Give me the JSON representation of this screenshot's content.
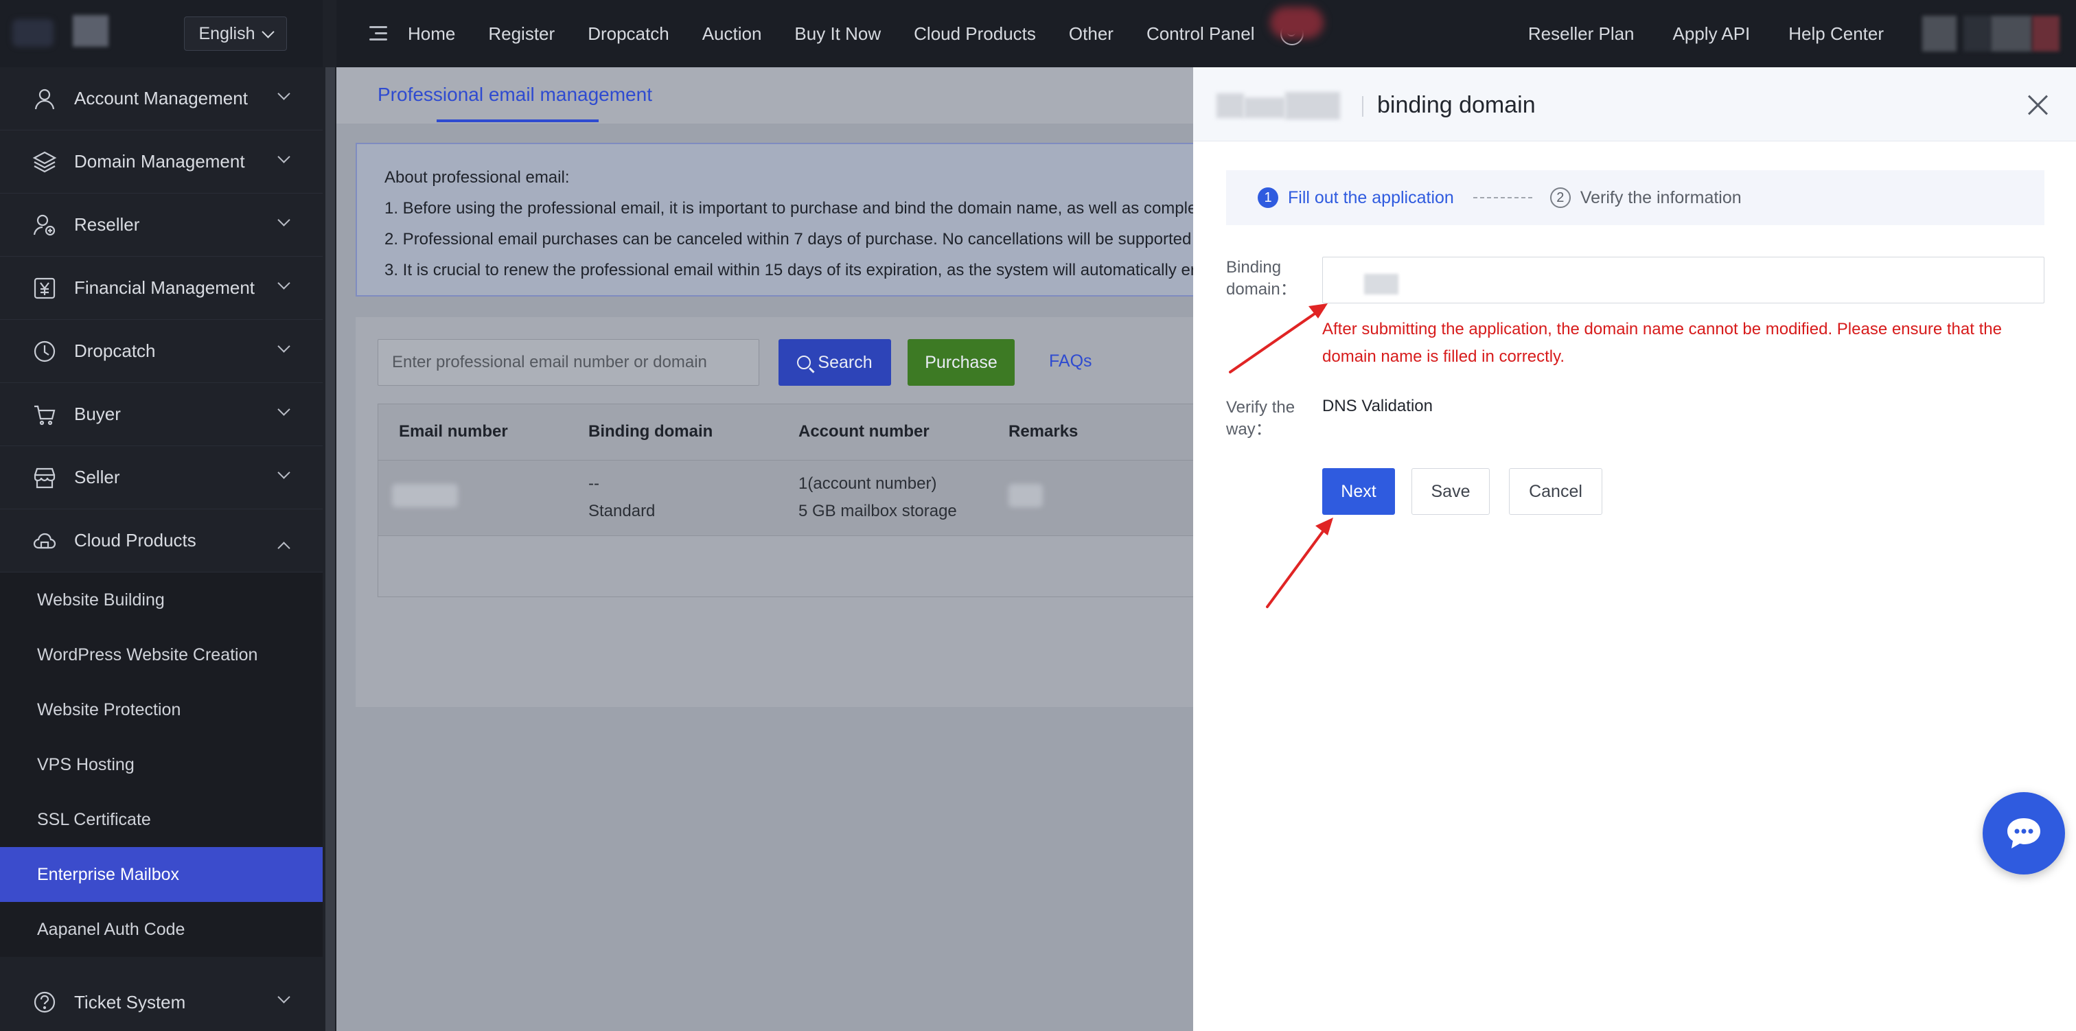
{
  "sidebar": {
    "language": "English",
    "items": [
      {
        "label": "Account Management",
        "icon": "user-icon"
      },
      {
        "label": "Domain Management",
        "icon": "layers-icon"
      },
      {
        "label": "Reseller",
        "icon": "reseller-icon"
      },
      {
        "label": "Financial Management",
        "icon": "yen-icon"
      },
      {
        "label": "Dropcatch",
        "icon": "clock-icon"
      },
      {
        "label": "Buyer",
        "icon": "cart-icon"
      },
      {
        "label": "Seller",
        "icon": "store-icon"
      },
      {
        "label": "Cloud Products",
        "icon": "cloud-icon"
      }
    ],
    "cloud_sub": [
      {
        "label": "Website Building"
      },
      {
        "label": "WordPress Website Creation"
      },
      {
        "label": "Website Protection"
      },
      {
        "label": "VPS Hosting"
      },
      {
        "label": "SSL Certificate"
      },
      {
        "label": "Enterprise Mailbox"
      },
      {
        "label": "Aapanel Auth Code"
      }
    ],
    "ticket": "Ticket System"
  },
  "topnav": {
    "links": [
      "Home",
      "Register",
      "Dropcatch",
      "Auction",
      "Buy It Now",
      "Cloud Products",
      "Other",
      "Control Panel"
    ],
    "right_links": [
      "Reseller Plan",
      "Apply API",
      "Help Center"
    ]
  },
  "main": {
    "tab": "Professional email management",
    "notice": {
      "title": "About professional email:",
      "lines": [
        "1. Before using the professional email, it is important to purchase and bind the domain name, as well as comple",
        "2. Professional email purchases can be canceled within 7 days of purchase. No cancellations will be supported",
        "3. It is crucial to renew the professional email within 15 days of its expiration, as the system will automatically er"
      ]
    },
    "search_placeholder": "Enter professional email number or domain",
    "search_label": "Search",
    "purchase_label": "Purchase",
    "faqs_label": "FAQs",
    "table": {
      "headers": [
        "Email number",
        "Binding domain",
        "Account number",
        "Remarks"
      ],
      "row": {
        "binding_domain": "--",
        "binding_type": "Standard",
        "account_number": "1(account number)",
        "storage": "5 GB mailbox storage"
      }
    }
  },
  "drawer": {
    "title": "binding domain",
    "steps": [
      {
        "num": "1",
        "label": "Fill out the application"
      },
      {
        "num": "2",
        "label": "Verify the information"
      }
    ],
    "binding_label": "Binding domain：",
    "warning": "After submitting the application, the domain name cannot be modified. Please ensure that the domain name is filled in correctly.",
    "verify_label": "Verify the way：",
    "verify_value": "DNS Validation",
    "next_label": "Next",
    "save_label": "Save",
    "cancel_label": "Cancel"
  },
  "colors": {
    "accent": "#2f5bdf",
    "sidebar_active": "#3b4ccc",
    "warning": "#d71b1b",
    "annotation_arrow": "#e02424"
  }
}
